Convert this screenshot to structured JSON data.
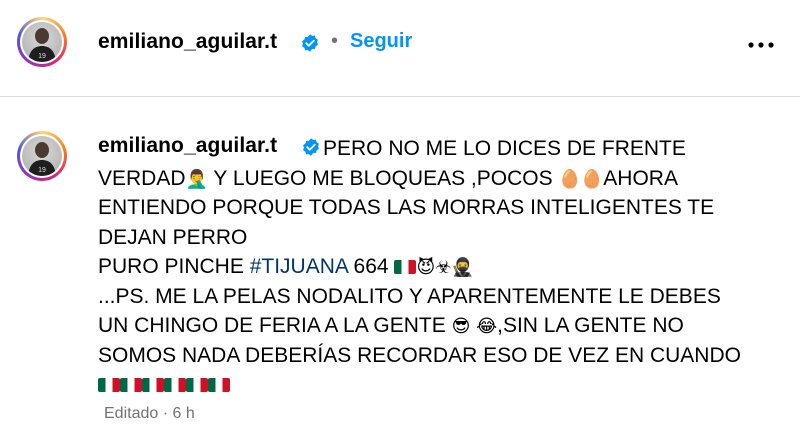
{
  "header": {
    "username": "emiliano_aguilar.t",
    "separator": "•",
    "follow_label": "Seguir"
  },
  "comment": {
    "username": "emiliano_aguilar.t",
    "lines": {
      "l1": "PERO NO ME LO DICES DE FRENTE",
      "l2a": "VERDAD",
      "l2_emoji": "🤦‍♂️",
      "l2b": " Y LUEGO ME BLOQUEAS ,POCOS ",
      "l2_eggs": "🥚🥚",
      "l2c": "AHORA",
      "l3": "ENTIENDO PORQUE TODAS LAS MORRAS INTELIGENTES TE",
      "l4": "DEJAN PERRO",
      "l5a": "PURO PINCHE ",
      "l5_hashtag": "#TIJUANA",
      "l5b": " 664 ",
      "l5_emojis": "😈☣🥷",
      "l6": "...PS. ME LA PELAS NODALITO Y APARENTEMENTE LE DEBES",
      "l7a": "UN CHINGO DE FERIA A LA GENTE ",
      "l7_emojis": "😎 😂",
      "l7b": ",SIN LA GENTE NO",
      "l8": "SOMOS NADA DEBERÍAS RECORDAR ESO DE VEZ EN CUANDO"
    },
    "flag_count": 6,
    "meta": "Editado · 6 h"
  },
  "colors": {
    "link_blue": "#0095f6",
    "hashtag": "#00376b",
    "verified": "#0095f6",
    "muted": "#737373",
    "divider": "#dbdbdb"
  },
  "icons": {
    "verified": "verified-badge-icon",
    "more": "more-horizontal-icon",
    "flag": "mexico-flag-icon"
  }
}
